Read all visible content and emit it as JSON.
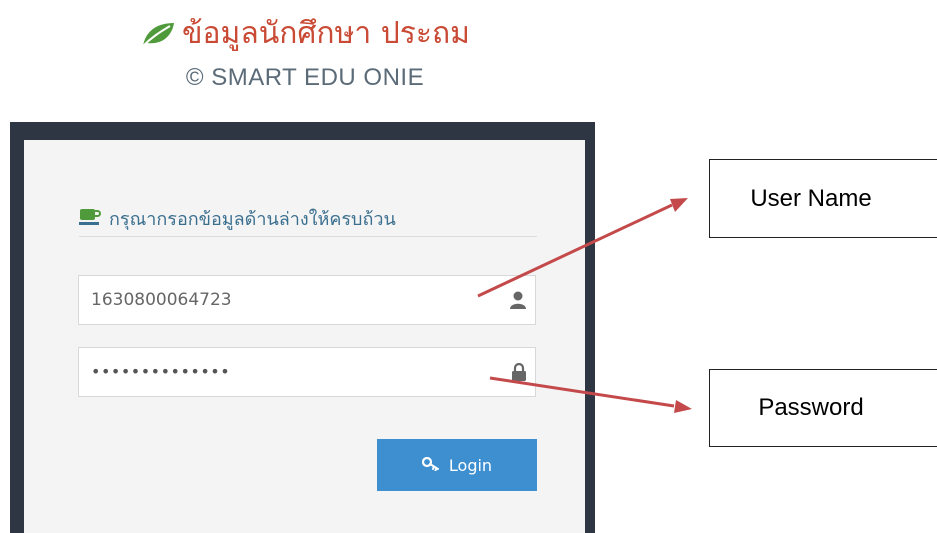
{
  "header": {
    "title": "ข้อมูลนักศึกษา ประถม",
    "subtitle": "© SMART EDU ONIE",
    "logo_icon": "leaf-icon",
    "brand_color": "#c94a35"
  },
  "login_panel": {
    "heading": "กรุณากรอกข้อมูลด้านล่างให้ครบถ้วน",
    "heading_icon": "coffee-icon",
    "username": {
      "value": "1630800064723",
      "icon": "user-icon"
    },
    "password": {
      "value": "••••••••••••••",
      "icon": "lock-icon"
    },
    "login_button": {
      "label": "Login",
      "icon": "key-icon",
      "color": "#3d8fd0"
    }
  },
  "annotations": {
    "username_label": "User Name",
    "password_label": "Password",
    "arrow_color": "#c4494a"
  }
}
